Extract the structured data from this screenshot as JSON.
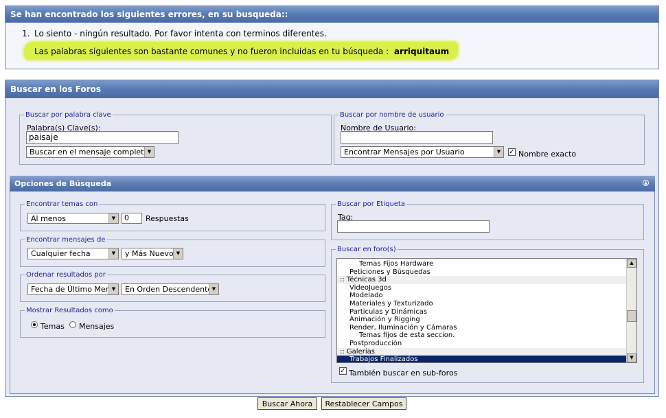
{
  "errors": {
    "title": "Se han encontrado los siguientes errores, en su busqueda::",
    "item_number": "1.",
    "item_text": "Lo siento - ningún resultado. Por favor intenta con terminos diferentes.",
    "common_words_text": "Las palabras siguientes son bastante comunes y no fueron incluidas en tu búsqueda :",
    "common_word": "arriquitaum"
  },
  "search": {
    "title": "Buscar en los Foros",
    "keyword": {
      "legend": "Buscar por palabra clave",
      "label": "Palabra(s) Clave(s):",
      "value": "paisaje",
      "mode_select": "Buscar en el mensaje completo"
    },
    "username": {
      "legend": "Buscar por nombre de usuario",
      "label": "Nombre de Usuario:",
      "value": "",
      "mode_select": "Encontrar Mensajes por Usuario",
      "exact_label": "Nombre exacto",
      "exact_checked": true
    }
  },
  "options": {
    "title": "Opciones de Búsqueda",
    "collapse_icon": "collapse-icon",
    "find_threads": {
      "legend": "Encontrar temas con",
      "select": "Al menos",
      "count": "0",
      "suffix": "Respuestas"
    },
    "find_posts": {
      "legend": "Encontrar mensajes de",
      "date_select": "Cualquier fecha",
      "direction_select": "y Más Nuevo"
    },
    "sort": {
      "legend": "Ordenar resultados por",
      "field_select": "Fecha de Último Mens",
      "order_select": "En Orden Descendente"
    },
    "show_as": {
      "legend": "Mostrar Resultados como",
      "threads_label": "Temas",
      "posts_label": "Mensajes",
      "selected": "Temas"
    },
    "tag": {
      "legend": "Buscar por Etiqueta",
      "label": "Tag:",
      "value": ""
    },
    "forums": {
      "legend": "Buscar en foro(s)",
      "items": [
        {
          "text": "Temas Fijos Hardware",
          "level": 2,
          "category": false,
          "selected": false
        },
        {
          "text": "Peticiones y Búsquedas",
          "level": 1,
          "category": false,
          "selected": false
        },
        {
          "text": ":: Técnicas 3d",
          "level": 0,
          "category": true,
          "selected": false
        },
        {
          "text": "VideoJuegos",
          "level": 1,
          "category": false,
          "selected": false
        },
        {
          "text": "Modelado",
          "level": 1,
          "category": false,
          "selected": false
        },
        {
          "text": "Materiales y Texturizado",
          "level": 1,
          "category": false,
          "selected": false
        },
        {
          "text": "Particulas y Dinámicas",
          "level": 1,
          "category": false,
          "selected": false
        },
        {
          "text": "Animación y Rigging",
          "level": 1,
          "category": false,
          "selected": false
        },
        {
          "text": "Render, Iluminación y Cámaras",
          "level": 1,
          "category": false,
          "selected": false
        },
        {
          "text": "Temas fijos de esta seccion.",
          "level": 2,
          "category": false,
          "selected": false
        },
        {
          "text": "Postproducción",
          "level": 1,
          "category": false,
          "selected": false
        },
        {
          "text": ":: Galerías",
          "level": 0,
          "category": true,
          "selected": false
        },
        {
          "text": "Trabajos Finalizados",
          "level": 1,
          "category": false,
          "selected": true
        }
      ],
      "subforums_label": "También buscar en sub-foros",
      "subforums_checked": true
    }
  },
  "buttons": {
    "search_now": "Buscar Ahora",
    "reset": "Restablecer Campos"
  },
  "colors": {
    "highlight": "#d9f04a",
    "header": "#5679b4",
    "link_legend": "#22229c",
    "selected_row": "#0a246a"
  }
}
